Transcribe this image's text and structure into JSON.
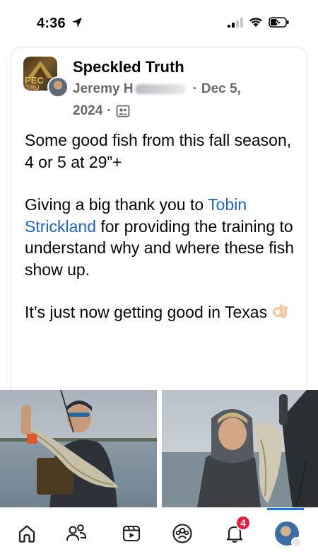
{
  "status": {
    "time": "4:36",
    "icons": [
      "location-arrow-icon",
      "signal-icon",
      "wifi-icon",
      "battery-charging-icon"
    ]
  },
  "post": {
    "group_name": "Speckled Truth",
    "group_logo_text": "PEC TRU",
    "author_prefix": "Jeremy H",
    "date_part1": "Dec 5,",
    "date_part2": "2024",
    "separator": "·",
    "audience_icon": "group-audience-icon",
    "paragraph1": "Some good fish from this fall season, 4 or 5 at 29”+",
    "paragraph2_start": "Giving a big thank you to ",
    "mention": "Tobin Strickland",
    "paragraph2_end": " for providing the training to understand why and where these fish show up.",
    "paragraph3": "It’s just now getting good in Texas",
    "paragraph3_emoji": "ok-hand-emoji"
  },
  "nav": {
    "items": [
      "home-icon",
      "friends-icon",
      "video-icon",
      "groups-icon",
      "notifications-icon",
      "profile-menu-icon"
    ],
    "notifications_badge": "4",
    "active_color": "#1877f2",
    "badge_color": "#e41e3f"
  }
}
